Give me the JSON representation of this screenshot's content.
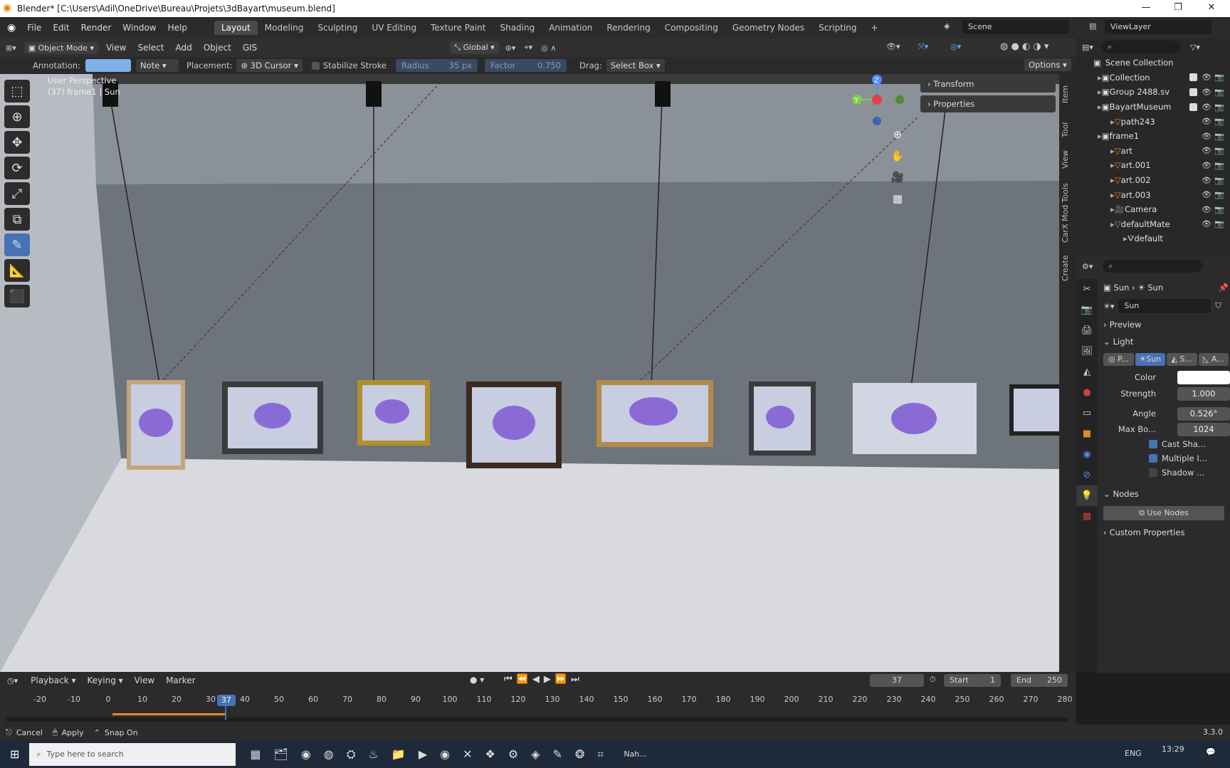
{
  "window": {
    "title": "Blender* [C:\\Users\\Adil\\OneDrive\\Bureau\\Projets\\3dBayart\\museum.blend]"
  },
  "menu": [
    "File",
    "Edit",
    "Render",
    "Window",
    "Help"
  ],
  "workspaces": [
    "Layout",
    "Modeling",
    "Sculpting",
    "UV Editing",
    "Texture Paint",
    "Shading",
    "Animation",
    "Rendering",
    "Compositing",
    "Geometry Nodes",
    "Scripting",
    "+"
  ],
  "scene": "Scene",
  "view_layer": "ViewLayer",
  "header3d": {
    "mode": "Object Mode",
    "menus": [
      "View",
      "Select",
      "Add",
      "Object",
      "GIS"
    ],
    "orientation": "Global"
  },
  "toolsettings": {
    "annotation_label": "Annotation:",
    "note": "Note",
    "placement_label": "Placement:",
    "placement": "3D Cursor",
    "stabilize": "Stabilize Stroke",
    "radius_label": "Radius",
    "radius_value": "35 px",
    "factor_label": "Factor",
    "factor_value": "0.750",
    "drag_label": "Drag:",
    "drag": "Select Box",
    "options": "Options"
  },
  "viewport": {
    "perspective": "User Perspective",
    "info": "(37) frame1 | Sun"
  },
  "npanel": {
    "transform": "Transform",
    "properties": "Properties",
    "tabs": [
      "Item",
      "Tool",
      "View",
      "CarX Mod Tools",
      "Create"
    ]
  },
  "gizmo": {
    "z": "Z",
    "y": "Y"
  },
  "outliner": {
    "root": "Scene Collection",
    "items": [
      {
        "name": "Collection",
        "indent": 1
      },
      {
        "name": "Group 2488.sv",
        "indent": 1
      },
      {
        "name": "BayartMuseum",
        "indent": 1
      },
      {
        "name": "path243",
        "indent": 2
      },
      {
        "name": "frame1",
        "indent": 1
      },
      {
        "name": "art",
        "indent": 2
      },
      {
        "name": "art.001",
        "indent": 2
      },
      {
        "name": "art.002",
        "indent": 2
      },
      {
        "name": "art.003",
        "indent": 2
      },
      {
        "name": "Camera",
        "indent": 2
      },
      {
        "name": "defaultMate",
        "indent": 2
      },
      {
        "name": "default",
        "indent": 3
      }
    ]
  },
  "properties": {
    "crumb1": "Sun",
    "crumb2": "Sun",
    "datablock": "Sun",
    "preview": "Preview",
    "light": "Light",
    "types": [
      "P...",
      "Sun",
      "S...",
      "A..."
    ],
    "color_label": "Color",
    "strength_label": "Strength",
    "strength": "1.000",
    "angle_label": "Angle",
    "angle": "0.526°",
    "maxbounce_label": "Max Bo...",
    "maxbounce": "1024",
    "cast_shadow": "Cast Sha...",
    "multiple_importance": "Multiple I...",
    "shadow_caustics": "Shadow ...",
    "nodes": "Nodes",
    "use_nodes": "Use Nodes",
    "custom": "Custom Properties"
  },
  "timeline": {
    "menus": [
      "Playback",
      "Keying",
      "View",
      "Marker"
    ],
    "current": "37",
    "start_label": "Start",
    "start": "1",
    "end_label": "End",
    "end": "250",
    "ticks": [
      "-20",
      "-10",
      "0",
      "10",
      "20",
      "30",
      "40",
      "50",
      "60",
      "70",
      "80",
      "90",
      "100",
      "110",
      "120",
      "130",
      "140",
      "150",
      "160",
      "170",
      "180",
      "190",
      "200",
      "210",
      "220",
      "230",
      "240",
      "250",
      "260",
      "270",
      "280"
    ]
  },
  "status": {
    "cancel": "Cancel",
    "apply": "Apply",
    "snap": "Snap On",
    "version": "3.3.0"
  },
  "taskbar": {
    "search": "Type here to search",
    "lang": "ENG",
    "time": "13:29",
    "nah": "Nah..."
  }
}
